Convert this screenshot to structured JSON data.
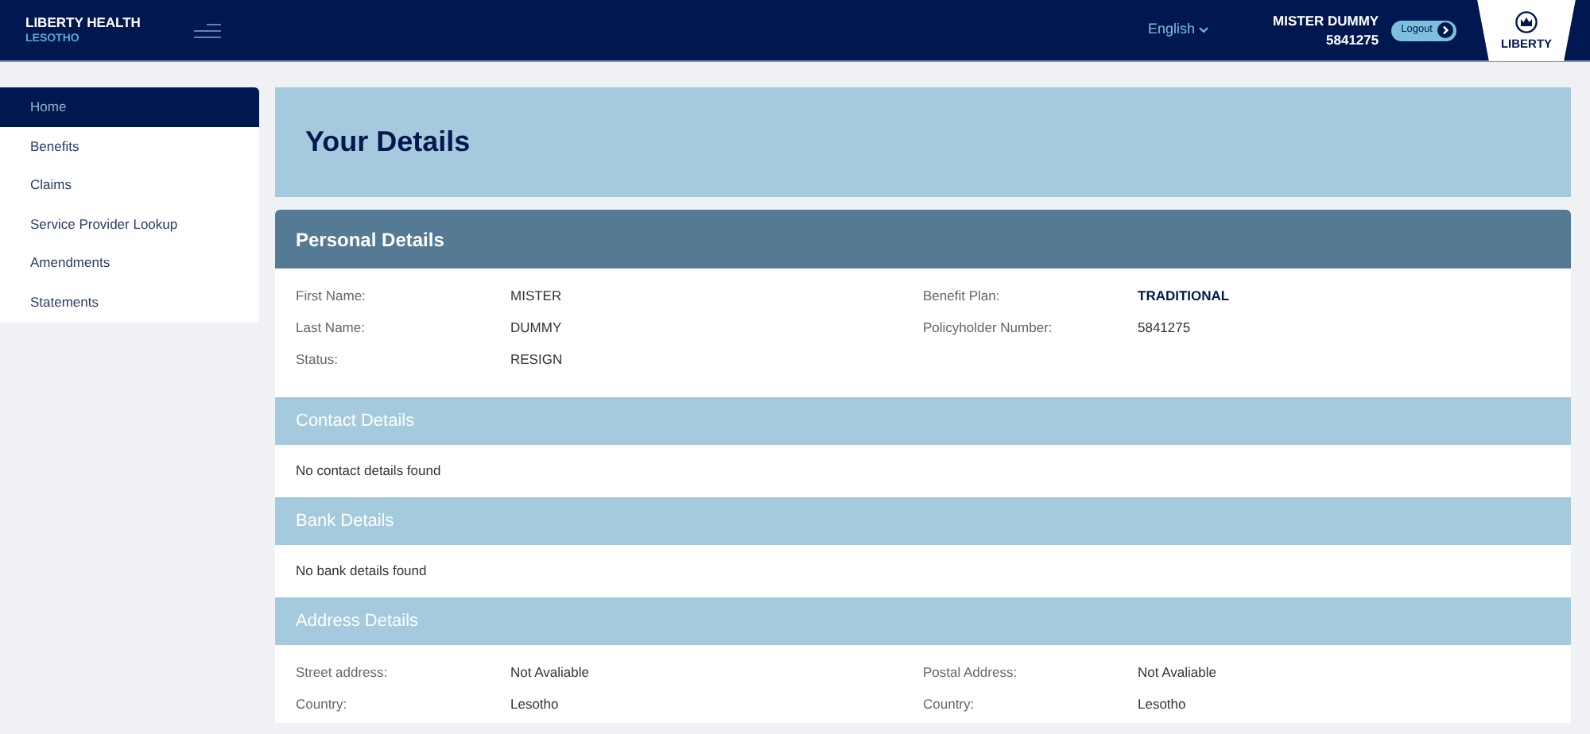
{
  "header": {
    "brand": "LIBERTY HEALTH",
    "region": "LESOTHO",
    "language": "English",
    "user_name": "MISTER DUMMY",
    "user_number": "5841275",
    "logout": "Logout",
    "logo_text": "LIBERTY"
  },
  "sidebar": {
    "items": [
      {
        "label": "Home",
        "selected": true
      },
      {
        "label": "Benefits",
        "selected": false
      },
      {
        "label": "Claims",
        "selected": false
      },
      {
        "label": "Service Provider Lookup",
        "selected": false
      },
      {
        "label": "Amendments",
        "selected": false
      },
      {
        "label": "Statements",
        "selected": false
      }
    ]
  },
  "banner": {
    "title": "Your Details"
  },
  "sections": [
    {
      "title": "Personal Details",
      "highlighted": true,
      "kind": "fields",
      "columns": [
        [
          {
            "label": "First Name:",
            "value": "MISTER",
            "emphasis": false
          },
          {
            "label": "Last Name:",
            "value": "DUMMY",
            "emphasis": false
          },
          {
            "label": "Status:",
            "value": "RESIGN",
            "emphasis": false
          }
        ],
        [
          {
            "label": "Benefit Plan:",
            "value": "TRADITIONAL",
            "emphasis": true
          },
          {
            "label": "Policyholder Number:",
            "value": "5841275",
            "emphasis": false
          }
        ]
      ]
    },
    {
      "title": "Contact Details",
      "highlighted": false,
      "kind": "message",
      "message": "No contact details found"
    },
    {
      "title": "Bank Details",
      "highlighted": false,
      "kind": "message",
      "message": "No bank details found"
    },
    {
      "title": "Address Details",
      "highlighted": false,
      "kind": "fields",
      "columns": [
        [
          {
            "label": "Street address:",
            "value": "Not Avaliable",
            "emphasis": false
          },
          {
            "label": "Country:",
            "value": "Lesotho",
            "emphasis": false
          }
        ],
        [
          {
            "label": "Postal Address:",
            "value": "Not Avaliable",
            "emphasis": false
          },
          {
            "label": "Country:",
            "value": "Lesotho",
            "emphasis": false
          }
        ]
      ]
    }
  ]
}
